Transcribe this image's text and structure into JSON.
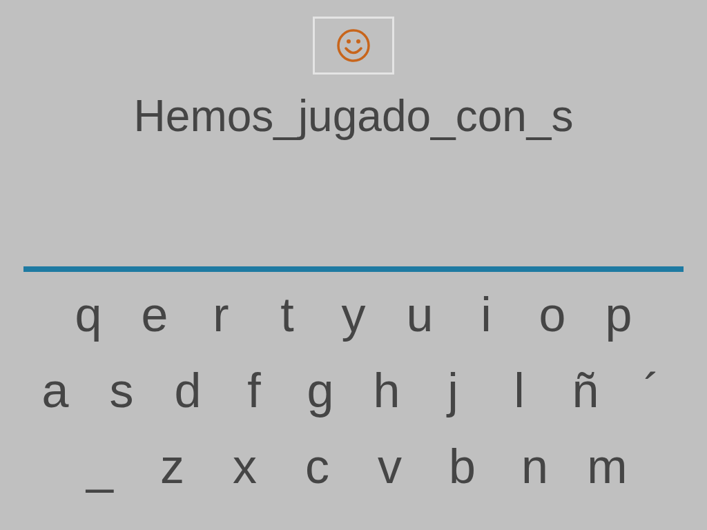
{
  "word": "Hemos_jugado_con_s",
  "keyboard": {
    "rows": [
      [
        "q",
        "e",
        "r",
        "t",
        "y",
        "u",
        "i",
        "o",
        "p"
      ],
      [
        "a",
        "s",
        "d",
        "f",
        "g",
        "h",
        "j",
        "l",
        "ñ",
        "´"
      ],
      [
        "_",
        "z",
        "x",
        "c",
        "v",
        "b",
        "n",
        "m"
      ]
    ]
  }
}
